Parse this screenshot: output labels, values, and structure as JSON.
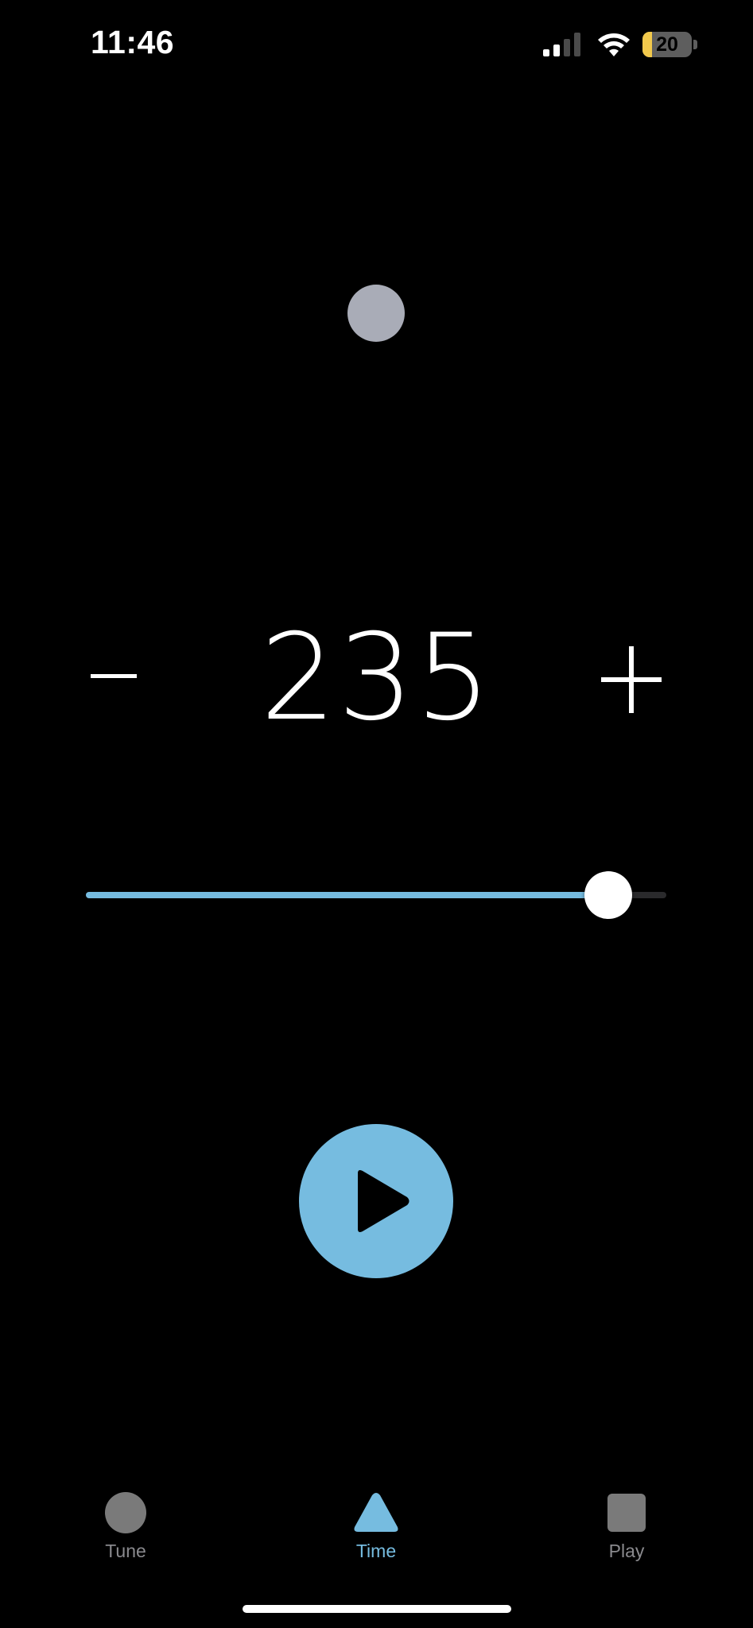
{
  "status_bar": {
    "time": "11:46",
    "battery_level": "20",
    "icons": [
      "signal-icon",
      "wifi-icon",
      "battery-icon"
    ]
  },
  "metronome": {
    "tempo": "235",
    "minus_label": "−",
    "plus_label": "+",
    "slider_fraction": 0.9,
    "beat_indicator": "beat-dot"
  },
  "player": {
    "play_icon": "play-icon"
  },
  "tab_bar": {
    "tabs": [
      {
        "label": "Tune",
        "icon": "circle-icon",
        "active": false
      },
      {
        "label": "Time",
        "icon": "triangle-icon",
        "active": true
      },
      {
        "label": "Play",
        "icon": "square-icon",
        "active": false
      }
    ]
  },
  "colors": {
    "accent": "#76bce0",
    "background": "#000000",
    "inactive": "#8a8a8e",
    "beat_dot": "#a9acb7",
    "battery_fill": "#f2c94c"
  }
}
